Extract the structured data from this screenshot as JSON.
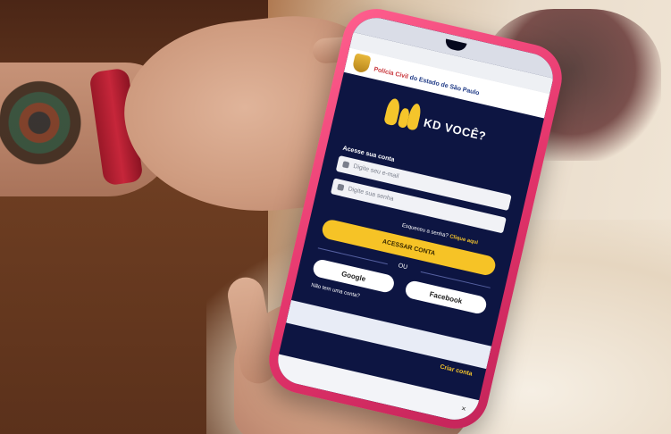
{
  "status_bar": {
    "url": ""
  },
  "site": {
    "subheader": "",
    "title_accent": "Polícia Civil",
    "title_rest": "do Estado de São Paulo"
  },
  "app": {
    "brand": "KD VOCÊ?"
  },
  "login": {
    "section_label": "Acesse sua conta",
    "email_placeholder": "Digite seu e-mail",
    "password_placeholder": "Digite sua senha",
    "forgot_text": "Esqueceu a senha?",
    "forgot_link": "Clique aqui",
    "submit_label": "ACESSAR CONTA",
    "or_label": "OU",
    "google_label": "Google",
    "facebook_label": "Facebook",
    "no_account": "Não tem uma conta?"
  },
  "banner": {
    "text": "",
    "cta": "Criar conta"
  },
  "bottom_bar": {
    "close_glyph": "×"
  },
  "colors": {
    "app_background": "#0d1542",
    "accent_yellow": "#f6c326",
    "phone_case": "#e2336a",
    "police_red": "#c8343a"
  }
}
